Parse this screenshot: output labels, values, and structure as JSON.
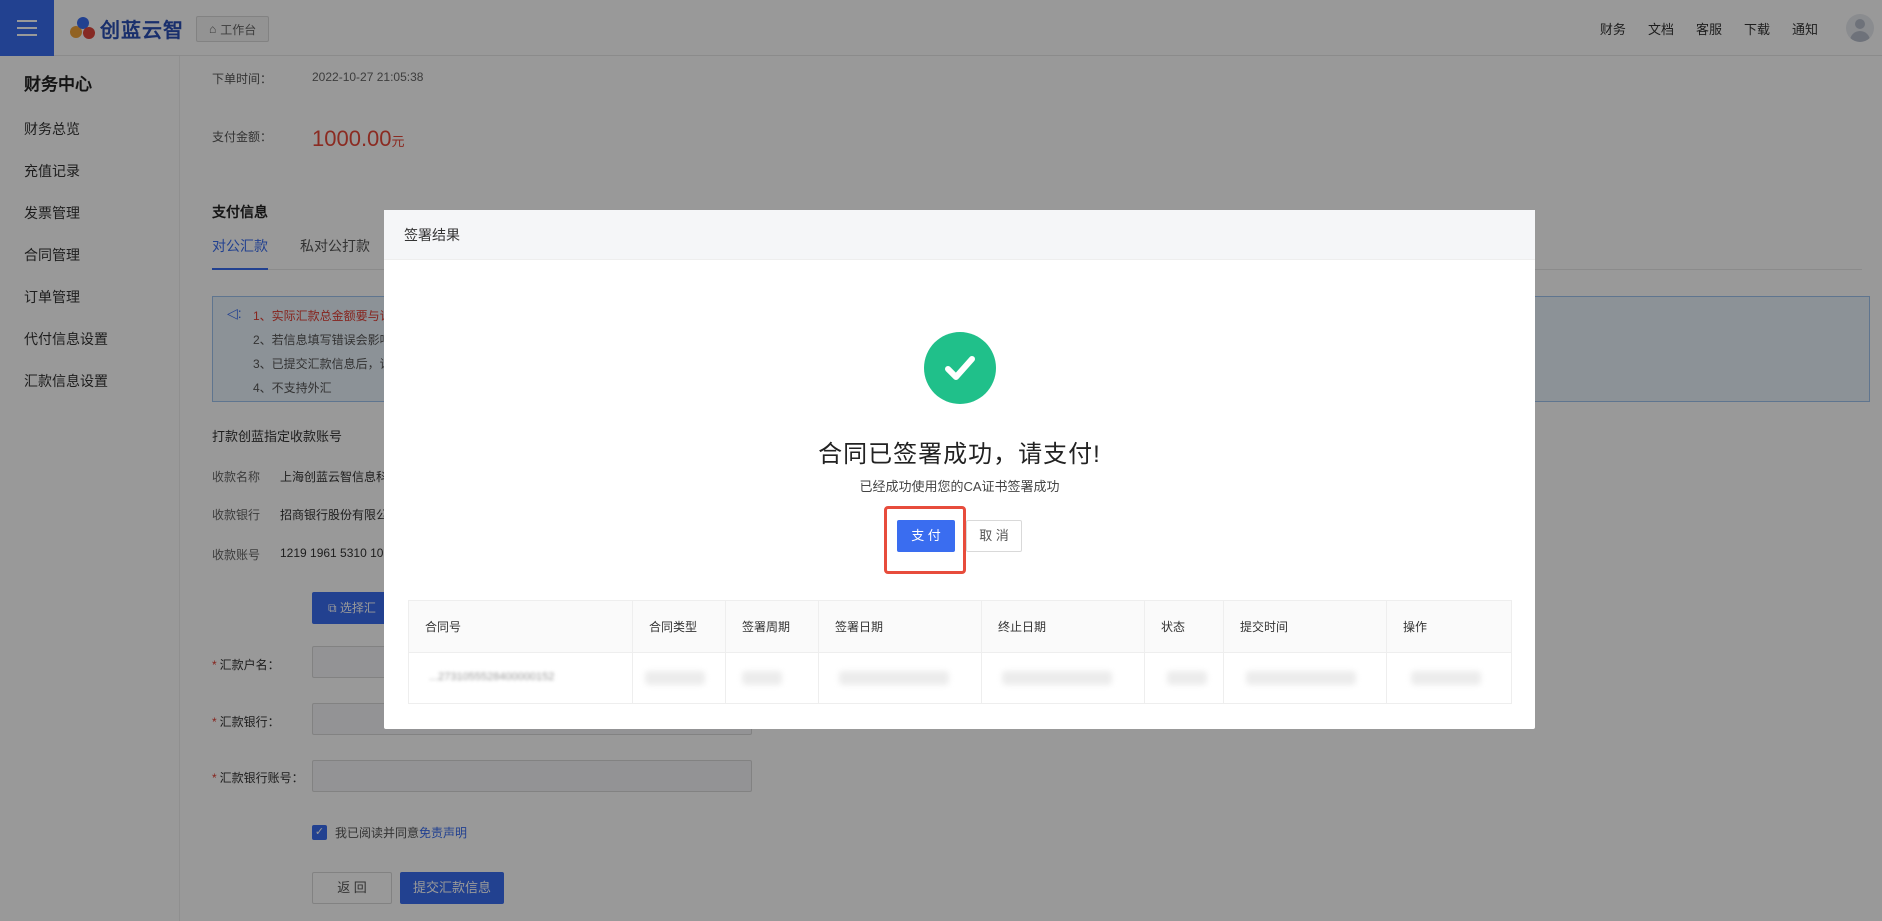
{
  "header": {
    "brand": "创蓝云智",
    "workbench_label": "工作台",
    "nav": [
      "财务",
      "文档",
      "客服",
      "下载",
      "通知"
    ]
  },
  "sidebar": {
    "title": "财务中心",
    "items": [
      {
        "label": "财务总览"
      },
      {
        "label": "充值记录"
      },
      {
        "label": "发票管理"
      },
      {
        "label": "合同管理"
      },
      {
        "label": "订单管理"
      },
      {
        "label": "代付信息设置"
      },
      {
        "label": "汇款信息设置"
      }
    ]
  },
  "main": {
    "order_time_label": "下单时间：",
    "order_time": "2022-10-27 21:05:38",
    "amount_label": "支付金额：",
    "amount": "1000.00",
    "amount_unit": "元",
    "payinfo_title": "支付信息",
    "tabs": [
      "对公汇款",
      "私对公打款"
    ],
    "notice": [
      "1、实际汇款总金额要与订",
      "2、若信息填写错误会影响",
      "3、已提交汇款信息后，请",
      "4、不支持外汇"
    ],
    "account_title": "打款创蓝指定收款账号",
    "payee_name_label": "收款名称",
    "payee_name": "上海创蓝云智信息科",
    "payee_bank_label": "收款银行",
    "payee_bank": "招商银行股份有限公",
    "payee_account_label": "收款账号",
    "payee_account": "1219 1961 5310 10",
    "select_btn": "选择汇",
    "form": {
      "name_label": "汇款户名：",
      "bank_label": "汇款银行：",
      "account_label": "汇款银行账号："
    },
    "agree_text": "我已阅读并同意",
    "agree_link": "免责声明",
    "back_btn": "返 回",
    "submit_btn": "提交汇款信息"
  },
  "modal": {
    "title": "签署结果",
    "message": "合同已签署成功，请支付!",
    "sub_message": "已经成功使用您的CA证书签署成功",
    "pay_btn": "支 付",
    "cancel_btn": "取 消",
    "table_headers": [
      "合同号",
      "合同类型",
      "签署周期",
      "签署日期",
      "终止日期",
      "状态",
      "提交时间",
      "操作"
    ],
    "row_contract_no_fragment": "...2731055528400000152"
  },
  "colors": {
    "accent": "#3a6df0",
    "success": "#20c08a",
    "amount": "#e8493a",
    "highlight": "#e74c3c"
  }
}
